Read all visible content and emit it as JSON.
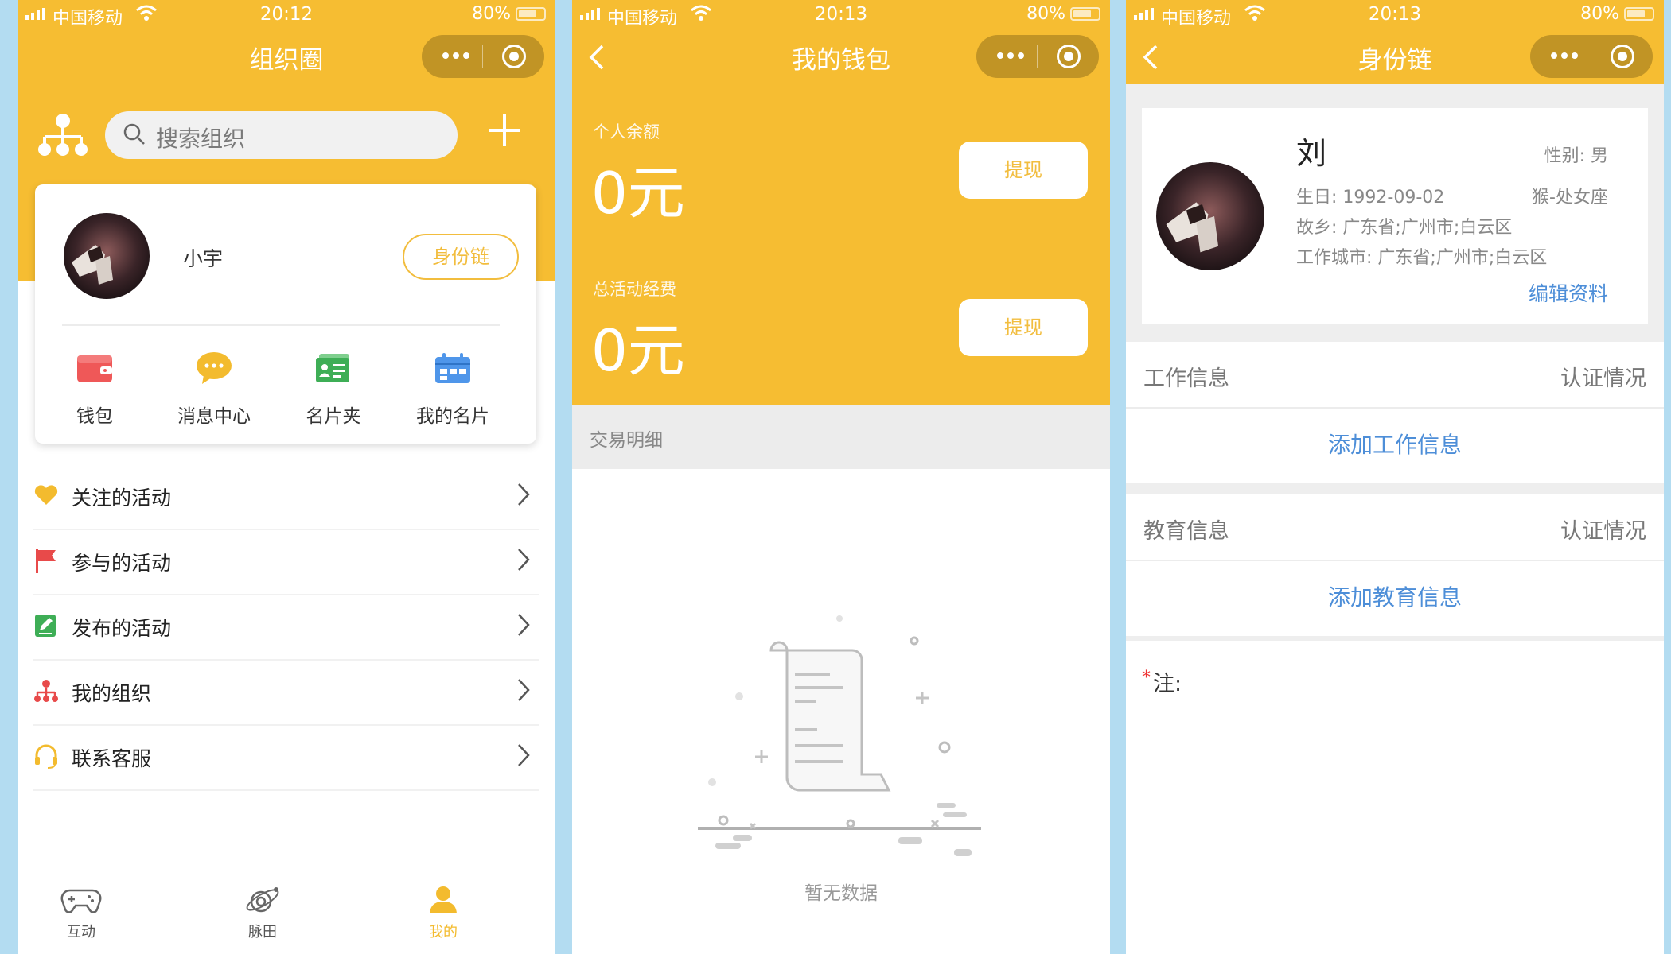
{
  "colors": {
    "brand_yellow": "#f6bd32",
    "link_blue": "#4d8ed8",
    "page_bg": "#b3dcf1"
  },
  "screen1": {
    "status": {
      "carrier": "中国移动",
      "time": "20:12",
      "battery": "80%"
    },
    "title": "组织圈",
    "search_placeholder": "搜索组织",
    "user_name": "小宇",
    "identity_chain_button": "身份链",
    "quick_actions": [
      {
        "label": "钱包",
        "icon": "wallet-icon"
      },
      {
        "label": "消息中心",
        "icon": "chat-bubble-icon"
      },
      {
        "label": "名片夹",
        "icon": "card-holder-icon"
      },
      {
        "label": "我的名片",
        "icon": "calendar-card-icon"
      }
    ],
    "menu": [
      {
        "label": "关注的活动",
        "icon": "heart-icon"
      },
      {
        "label": "参与的活动",
        "icon": "flag-icon"
      },
      {
        "label": "发布的活动",
        "icon": "edit-note-icon"
      },
      {
        "label": "我的组织",
        "icon": "org-tree-icon"
      },
      {
        "label": "联系客服",
        "icon": "headset-icon"
      }
    ],
    "tabs": [
      {
        "label": "互动",
        "icon": "gamepad-icon"
      },
      {
        "label": "脉田",
        "icon": "planet-icon"
      },
      {
        "label": "我的",
        "icon": "person-icon",
        "active": true
      }
    ]
  },
  "screen2": {
    "status": {
      "carrier": "中国移动",
      "time": "20:13",
      "battery": "80%"
    },
    "title": "我的钱包",
    "personal_balance_label": "个人余额",
    "personal_balance_value": "0元",
    "activity_fund_label": "总活动经费",
    "activity_fund_value": "0元",
    "withdraw_label": "提现",
    "transactions_header": "交易明细",
    "empty_text": "暂无数据"
  },
  "screen3": {
    "status": {
      "carrier": "中国移动",
      "time": "20:13",
      "battery": "80%"
    },
    "title": "身份链",
    "name": "刘",
    "gender": "性别: 男",
    "birthday": "生日:  1992-09-02",
    "zodiac": "猴-处女座",
    "hometown": "故乡:  广东省;广州市;白云区",
    "work_city": "工作城市:  广东省;广州市;白云区",
    "edit_profile": "编辑资料",
    "work_section": {
      "title": "工作信息",
      "status": "认证情况",
      "add": "添加工作信息"
    },
    "edu_section": {
      "title": "教育信息",
      "status": "认证情况",
      "add": "添加教育信息"
    },
    "note_star": "*",
    "note_label": "注:"
  }
}
